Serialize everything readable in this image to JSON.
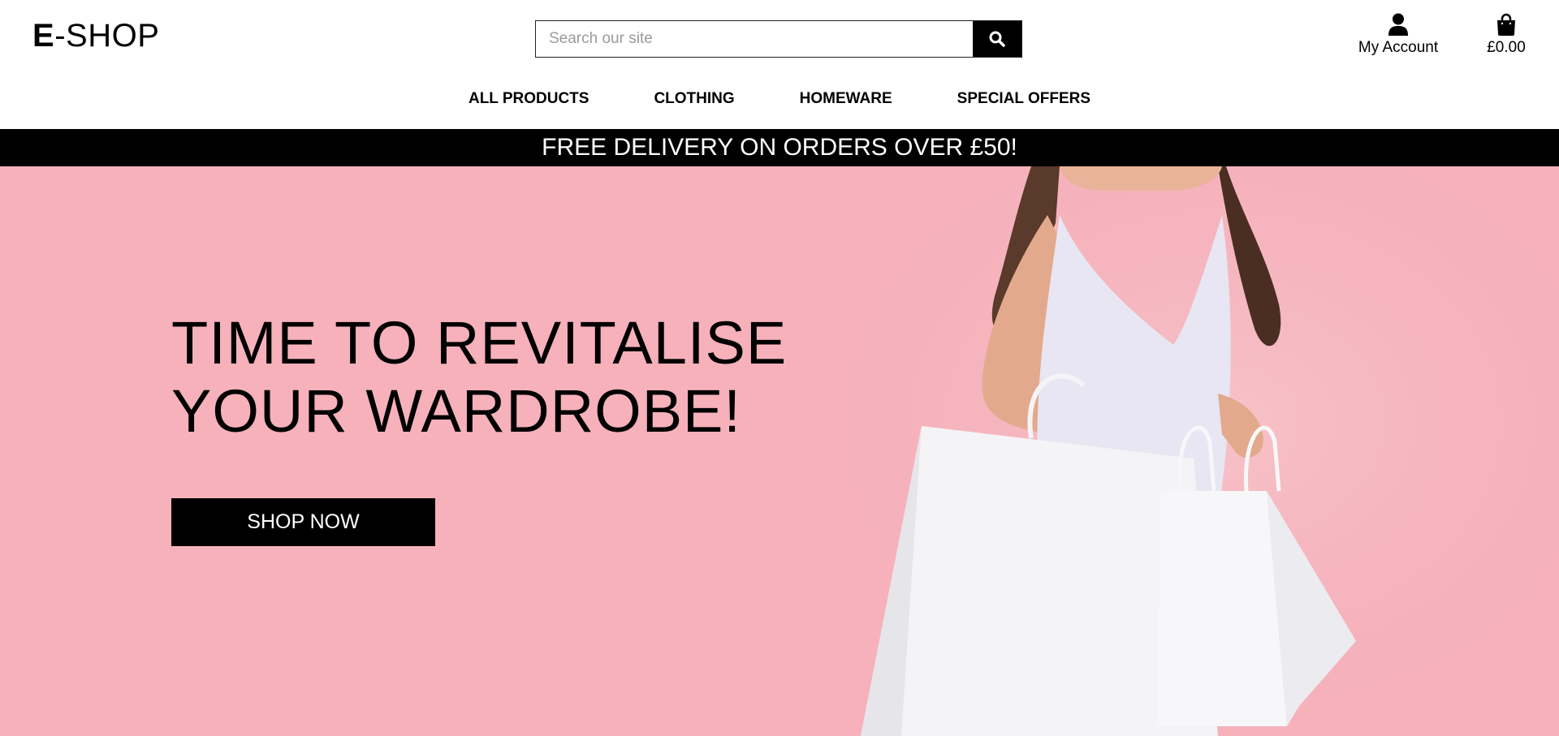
{
  "header": {
    "logo_bold": "E",
    "logo_rest": "-SHOP",
    "search": {
      "placeholder": "Search our site",
      "icon": "search-icon"
    },
    "account": {
      "label": "My Account",
      "icon": "user-icon"
    },
    "bag": {
      "total": "£0.00",
      "icon": "shopping-bag-icon"
    }
  },
  "nav": {
    "items": [
      {
        "label": "ALL PRODUCTS"
      },
      {
        "label": "CLOTHING"
      },
      {
        "label": "HOMEWARE"
      },
      {
        "label": "SPECIAL OFFERS"
      }
    ]
  },
  "banner": {
    "text": "FREE DELIVERY ON ORDERS OVER £50!"
  },
  "hero": {
    "title_line1": "TIME TO REVITALISE",
    "title_line2": "YOUR WARDROBE!",
    "cta_label": "SHOP NOW",
    "background_color": "#f6b1bb"
  }
}
